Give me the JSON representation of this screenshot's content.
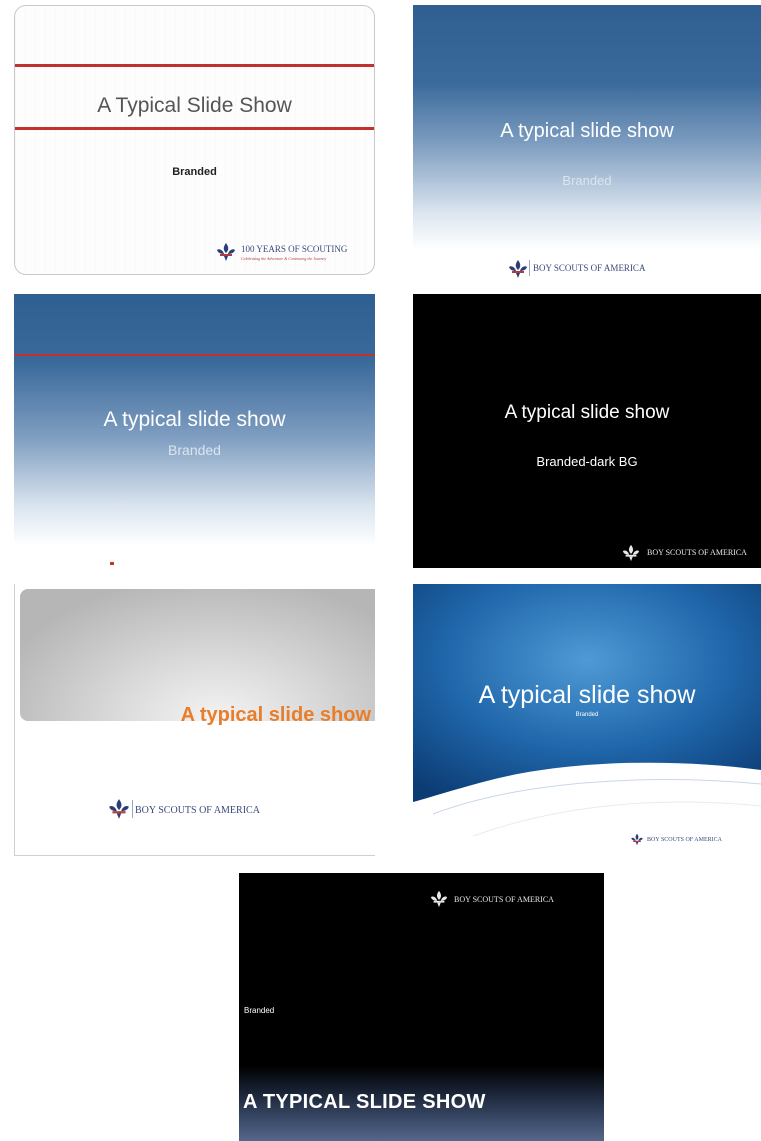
{
  "slides": [
    {
      "title": "A Typical Slide Show",
      "subtitle": "Branded",
      "logo_text": "100 YEARS OF SCOUTING",
      "logo_tagline": "Celebrating the Adventure & Continuing the Journey",
      "logo_icon": "fleur-de-lis-icon",
      "accent_color": "#c2312e"
    },
    {
      "title": "A typical slide show",
      "subtitle": "Branded",
      "logo_text": "BOY SCOUTS OF AMERICA",
      "logo_icon": "fleur-de-lis-icon",
      "background_colors": [
        "#2f5f91",
        "#ffffff"
      ]
    },
    {
      "title": "A typical slide show",
      "subtitle": "Branded",
      "accent_color": "#c2312e",
      "background_colors": [
        "#2f5f91",
        "#ffffff"
      ]
    },
    {
      "title": "A typical slide show",
      "subtitle": "Branded-dark BG",
      "logo_text": "BOY SCOUTS OF AMERICA",
      "logo_icon": "fleur-de-lis-icon",
      "background_color": "#000000"
    },
    {
      "title": "A typical slide show",
      "logo_text": "BOY SCOUTS OF AMERICA",
      "logo_icon": "fleur-de-lis-icon",
      "title_color": "#e87d2a"
    },
    {
      "title": "A typical slide show",
      "subtitle": "Branded",
      "logo_text": "BOY SCOUTS OF AMERICA",
      "logo_icon": "fleur-de-lis-icon",
      "background_color": "#1f5f9f"
    },
    {
      "title": "A TYPICAL SLIDE SHOW",
      "subtitle": "Branded",
      "logo_text": "BOY SCOUTS OF AMERICA",
      "logo_icon": "fleur-de-lis-icon",
      "background_color": "#000000"
    }
  ]
}
